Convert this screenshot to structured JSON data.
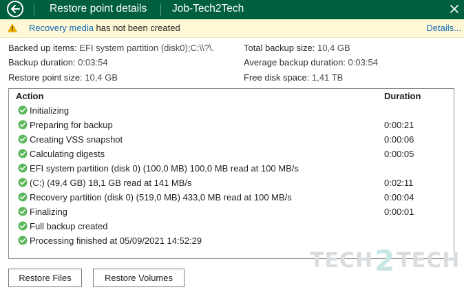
{
  "window": {
    "title": "Restore point details",
    "job_name": "Job-Tech2Tech"
  },
  "warning": {
    "link_text": "Recovery media",
    "message": " has not been created",
    "details_label": "Details..."
  },
  "summary": {
    "backed_up_items": {
      "label": "Backed up items:",
      "value": "EFI system partition (disk0);C:\\\\?\\."
    },
    "backup_duration": {
      "label": "Backup duration:",
      "value": "0:03:54"
    },
    "restore_point_size": {
      "label": "Restore point size:",
      "value": "10,4 GB"
    },
    "total_backup_size": {
      "label": "Total backup size:",
      "value": "10,4 GB"
    },
    "average_backup_duration": {
      "label": "Average backup duration:",
      "value": "0:03:54"
    },
    "free_disk_space": {
      "label": "Free disk space:",
      "value": "1,41 TB"
    }
  },
  "log": {
    "columns": {
      "action": "Action",
      "duration": "Duration"
    },
    "rows": [
      {
        "action": "Initializing",
        "duration": ""
      },
      {
        "action": "Preparing for backup",
        "duration": "0:00:21"
      },
      {
        "action": "Creating VSS snapshot",
        "duration": "0:00:06"
      },
      {
        "action": "Calculating digests",
        "duration": "0:00:05"
      },
      {
        "action": "EFI system partition (disk 0) (100,0 MB) 100,0 MB read at 100 MB/s",
        "duration": ""
      },
      {
        "action": "(C:) (49,4 GB) 18,1 GB read at 141 MB/s",
        "duration": "0:02:11"
      },
      {
        "action": "Recovery partition (disk 0) (519,0 MB) 433,0 MB read at 100 MB/s",
        "duration": "0:00:04"
      },
      {
        "action": "Finalizing",
        "duration": "0:00:01"
      },
      {
        "action": "Full backup created",
        "duration": ""
      },
      {
        "action": "Processing finished at 05/09/2021 14:52:29",
        "duration": ""
      }
    ],
    "status_icon": "success-check-icon"
  },
  "buttons": {
    "restore_files": "Restore Files",
    "restore_volumes": "Restore Volumes"
  },
  "watermark": {
    "part1": "TECH",
    "part2": "2",
    "part3": "TECH"
  },
  "colors": {
    "titlebar": "#00603e",
    "warning_bg": "#fff8d6",
    "warning_icon": "#f5b400",
    "link": "#0f6ab4",
    "success": "#5cb85c"
  }
}
